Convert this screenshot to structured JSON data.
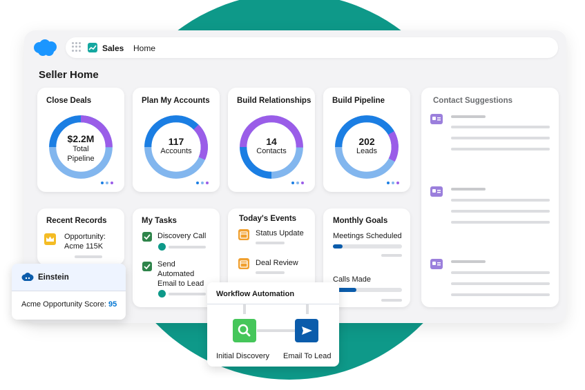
{
  "header": {
    "app_name": "Sales",
    "nav_home": "Home"
  },
  "page": {
    "title": "Seller Home"
  },
  "kpi_cards": [
    {
      "title": "Close Deals",
      "value": "$2.2M",
      "sub1": "Total",
      "sub2": "Pipeline"
    },
    {
      "title": "Plan My Accounts",
      "value": "117",
      "sub1": "Accounts",
      "sub2": ""
    },
    {
      "title": "Build Relationships",
      "value": "14",
      "sub1": "Contacts",
      "sub2": ""
    },
    {
      "title": "Build Pipeline",
      "value": "202",
      "sub1": "Leads",
      "sub2": ""
    }
  ],
  "recent_records": {
    "title": "Recent Records",
    "line1": "Opportunity:",
    "line2": "Acme 115K"
  },
  "my_tasks": {
    "title": "My Tasks",
    "task1": "Discovery Call",
    "task2_l1": "Send",
    "task2_l2": "Automated",
    "task2_l3": "Email to Lead"
  },
  "todays_events": {
    "title": "Today's Events",
    "event1": "Status Update",
    "event2": "Deal Review"
  },
  "monthly_goals": {
    "title": "Monthly Goals",
    "goals": [
      {
        "label": "Meetings Scheduled",
        "progress": 0.14
      },
      {
        "label": "Calls Made",
        "progress": 0.34
      }
    ]
  },
  "contact_suggestions": {
    "title": "Contact Suggestions"
  },
  "einstein": {
    "name": "Einstein",
    "score_label": "Acme Opportunity Score:",
    "score_value": "95"
  },
  "workflow": {
    "title": "Workflow Automation",
    "step1": "Initial Discovery",
    "step2": "Email To Lead"
  },
  "colors": {
    "teal": "#0e9989",
    "salesforce_blue": "#1b96ff",
    "donut_dark_blue": "#1b7ee3",
    "donut_light_blue": "#82b6ee",
    "donut_purple": "#9a5de8",
    "check_green": "#2e844a",
    "event_orange": "#f0a030",
    "search_green": "#45c65a",
    "send_blue": "#0b5cab",
    "contact_purple": "#9b7fdc"
  }
}
